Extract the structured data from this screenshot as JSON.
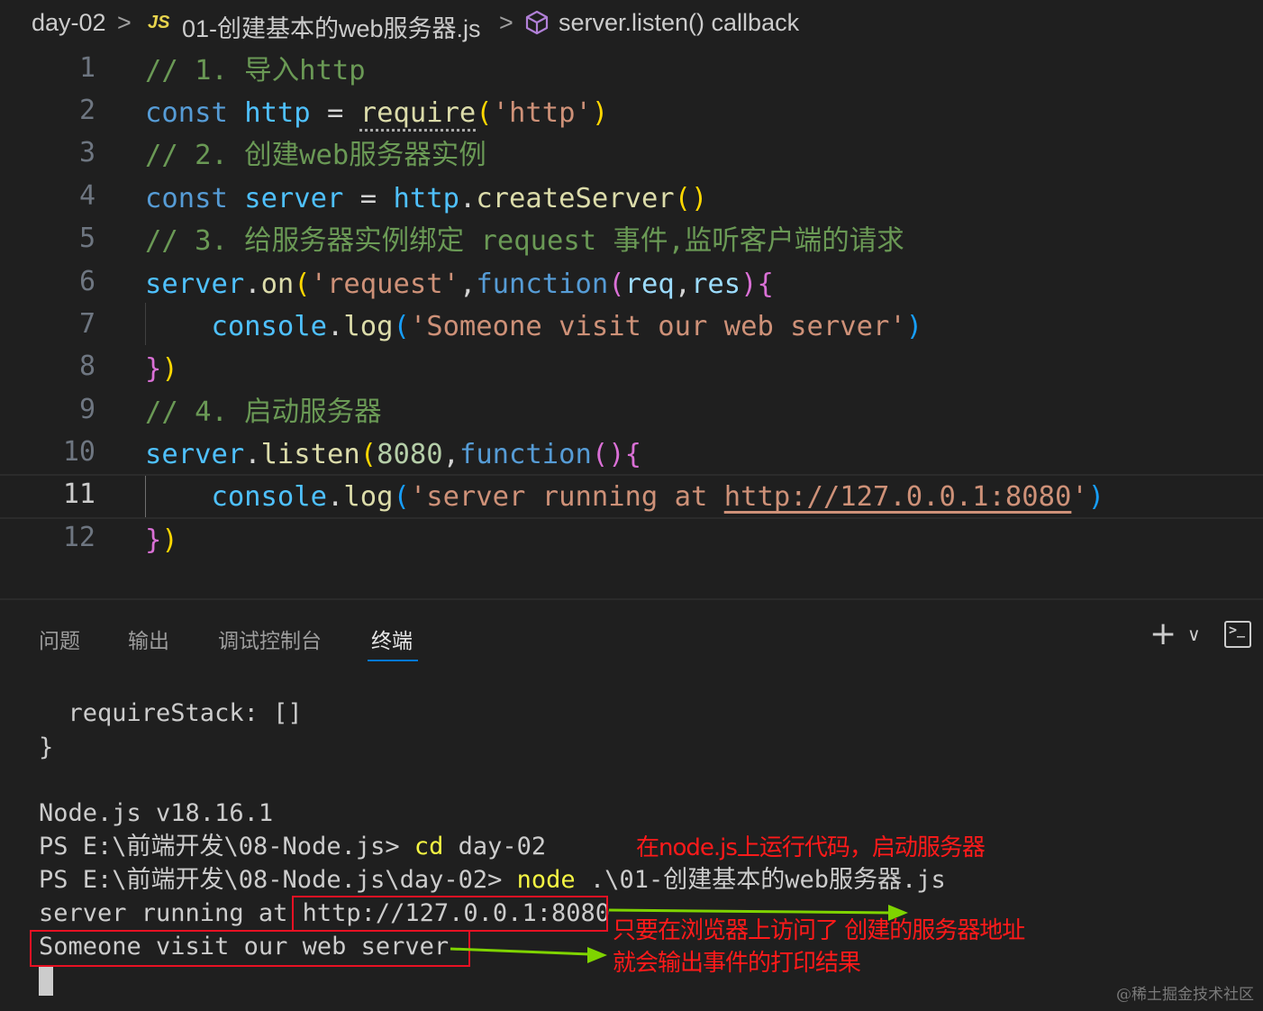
{
  "breadcrumb": {
    "folder": "day-02",
    "sep": ">",
    "file_icon_label": "JS",
    "file": "01-创建基本的web服务器.js",
    "symbol": "server.listen() callback"
  },
  "editor": {
    "line_numbers": [
      "1",
      "2",
      "3",
      "4",
      "5",
      "6",
      "7",
      "8",
      "9",
      "10",
      "11",
      "12"
    ],
    "current_line": "11",
    "lines": {
      "l1": {
        "comment": "// 1. 导入http"
      },
      "l2": {
        "kw": "const",
        "name": "http",
        "op": " = ",
        "fn": "require",
        "open": "(",
        "str": "'http'",
        "close": ")"
      },
      "l3": {
        "comment": "// 2. 创建web服务器实例"
      },
      "l4": {
        "kw": "const",
        "name": "server",
        "op": " = ",
        "obj": "http",
        "dot": ".",
        "fn": "createServer",
        "open": "(",
        "close": ")"
      },
      "l5": {
        "comment": "// 3. 给服务器实例绑定 request 事件,监听客户端的请求"
      },
      "l6": {
        "obj": "server",
        "dot": ".",
        "fn": "on",
        "open": "(",
        "str": "'request'",
        "comma": ",",
        "kw": "function",
        "popen": "(",
        "p1": "req",
        "pcomma": ",",
        "p2": "res",
        "pclose": ")",
        "brace": "{"
      },
      "l7": {
        "indent": "    ",
        "obj": "console",
        "dot": ".",
        "fn": "log",
        "open": "(",
        "str": "'Someone visit our web server'",
        "close": ")"
      },
      "l8": {
        "brace": "}",
        "close": ")"
      },
      "l9": {
        "comment": "// 4. 启动服务器"
      },
      "l10": {
        "obj": "server",
        "dot": ".",
        "fn": "listen",
        "open": "(",
        "num": "8080",
        "comma": ",",
        "kw": "function",
        "popen": "(",
        "pclose": ")",
        "brace": "{"
      },
      "l11": {
        "indent": "    ",
        "obj": "console",
        "dot": ".",
        "fn": "log",
        "open": "(",
        "str_a": "'server running at ",
        "url": "http://127.0.0.1:8080",
        "str_b": "'",
        "close": ")"
      },
      "l12": {
        "brace": "}",
        "close": ")"
      }
    }
  },
  "panel": {
    "tabs": [
      "问题",
      "输出",
      "调试控制台",
      "终端"
    ],
    "active_tab": "终端",
    "accent": "#0078d4"
  },
  "terminal": {
    "lines": [
      "  requireStack: []",
      "}",
      "",
      "Node.js v18.16.1"
    ],
    "ps1_prompt": "PS E:\\前端开发\\08-Node.js> ",
    "ps1_cmd": "cd",
    "ps1_arg": " day-02",
    "ps2_prompt": "PS E:\\前端开发\\08-Node.js\\day-02> ",
    "ps2_cmd": "node",
    "ps2_arg": " .\\01-创建基本的web服务器.js",
    "out1_prefix": "server running at ",
    "out1_url": "http://127.0.0.1:8080",
    "out2": "Someone visit our web server"
  },
  "annotations": {
    "note1": "在node.js上运行代码，启动服务器",
    "note2": "只要在浏览器上访问了 创建的服务器地址",
    "note3": "就会输出事件的打印结果",
    "box_color": "#e81123",
    "arrow_color": "#7fd400"
  },
  "watermark": "@稀土掘金技术社区"
}
